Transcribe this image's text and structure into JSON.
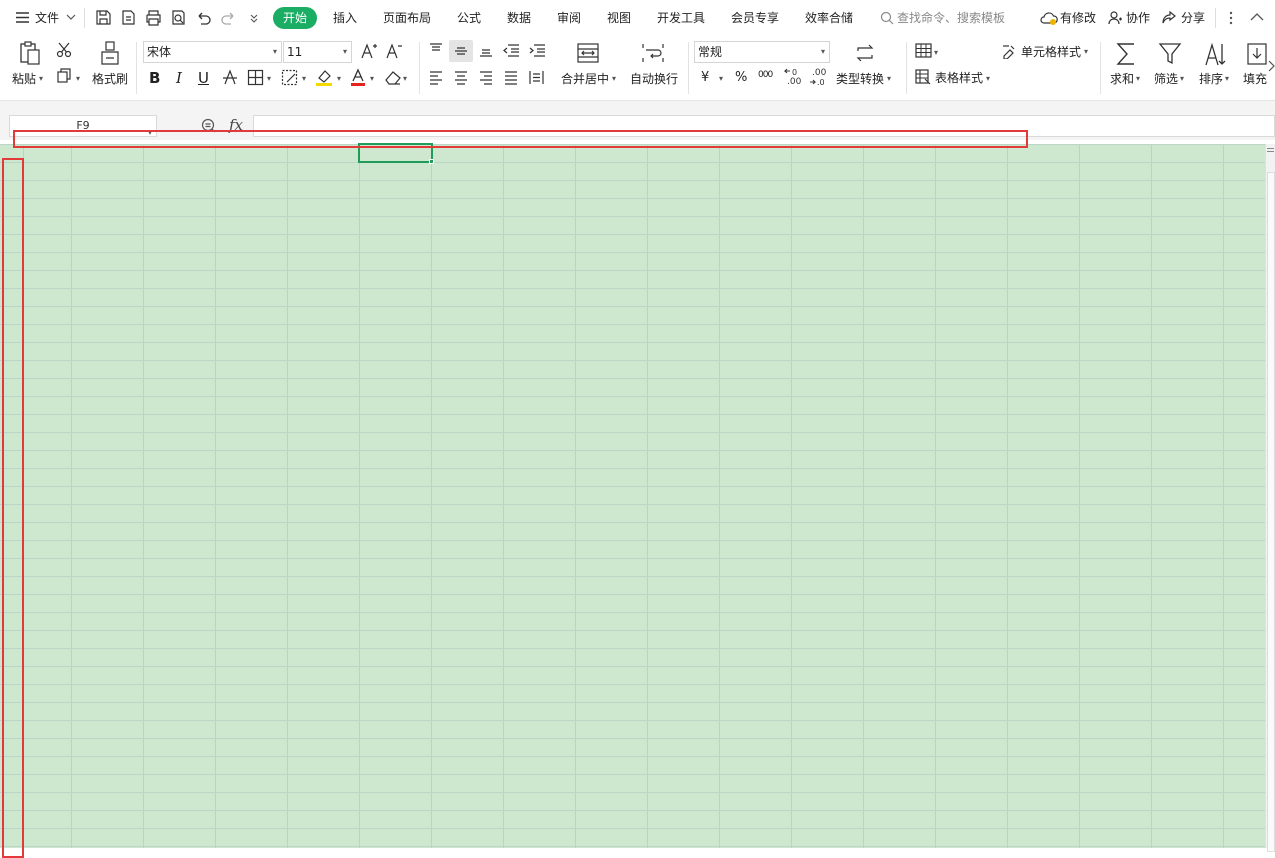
{
  "menu": {
    "file": "文件",
    "tabs": [
      "开始",
      "插入",
      "页面布局",
      "公式",
      "数据",
      "审阅",
      "视图",
      "开发工具",
      "会员专享",
      "效率合储"
    ],
    "search_placeholder": "查找命令、搜索模板",
    "modified": "有修改",
    "collaborate": "协作",
    "share": "分享"
  },
  "ribbon": {
    "paste": "粘贴",
    "format_painter": "格式刷",
    "font_name": "宋体",
    "font_size": "11",
    "bold": "B",
    "italic": "I",
    "underline": "U",
    "merge_center": "合并居中",
    "auto_wrap": "自动换行",
    "number_format": "常规",
    "currency": "¥",
    "percent": "%",
    "thousands": "000",
    "inc_decimal": ".00",
    "dec_decimal": ".00",
    "type_convert": "类型转换",
    "cell_style": "单元格样式",
    "table_style": "表格样式",
    "sum": "求和",
    "filter": "筛选",
    "sort": "排序",
    "fill": "填充"
  },
  "formula_bar": {
    "cell_ref": "F9",
    "fx": "fx",
    "value": ""
  },
  "colors": {
    "accent": "#1aad63",
    "grid_bg": "#cde8cf",
    "annotation": "#e23a3a",
    "selection": "#1f9c5a"
  }
}
